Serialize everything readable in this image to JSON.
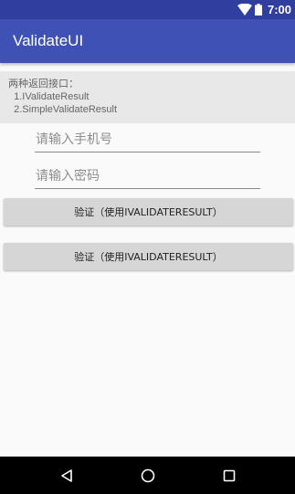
{
  "status_bar": {
    "time": "7:00",
    "icons": [
      "wifi-icon",
      "battery-icon"
    ]
  },
  "app_bar": {
    "title": "ValidateUI"
  },
  "info": {
    "lines": [
      "两种返回接口：",
      "  1.IValidateResult",
      "  2.SimpleValidateResult"
    ]
  },
  "form": {
    "phone_placeholder": "请输入手机号",
    "password_placeholder": "请输入密码"
  },
  "buttons": {
    "validate_1": "验证（使用IVALIDATERESULT）",
    "validate_2": "验证（使用IVALIDATERESULT）"
  },
  "nav_bar": {
    "icons": [
      "back-icon",
      "home-icon",
      "recents-icon"
    ]
  },
  "colors": {
    "primary": "#3f51b5",
    "primary_dark": "#303f9f",
    "button": "#d6d6d6"
  }
}
